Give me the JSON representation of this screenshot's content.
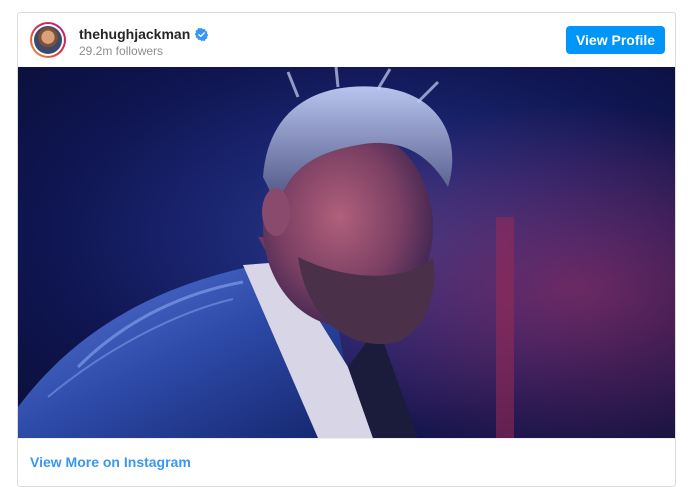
{
  "header": {
    "username": "thehughjackman",
    "followers": "29.2m followers",
    "view_profile_label": "View Profile"
  },
  "photo": {
    "alt": "thehughjackman post photo"
  },
  "footer": {
    "view_more_label": "View More on Instagram"
  },
  "colors": {
    "button_bg": "#0095f6",
    "link": "#3897f0",
    "verified": "#3897f0"
  }
}
